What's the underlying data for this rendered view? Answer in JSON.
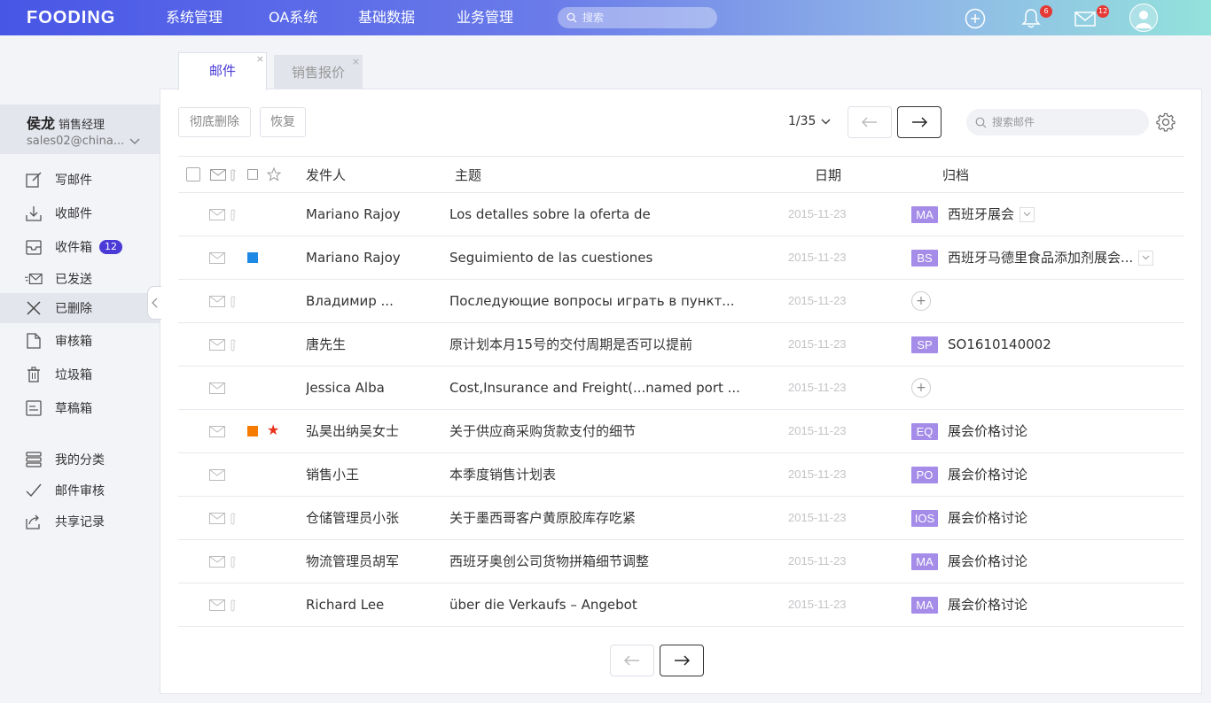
{
  "app": {
    "logo": "FOODING",
    "search_placeholder": "搜索",
    "notif_count": "6",
    "mail_count": "12"
  },
  "nav": [
    "系统管理",
    "OA系统",
    "基础数据",
    "业务管理"
  ],
  "tabs": [
    {
      "label": "邮件",
      "active": true
    },
    {
      "label": "销售报价",
      "active": false
    }
  ],
  "user": {
    "name": "侯龙",
    "role": "销售经理",
    "email": "sales02@china..."
  },
  "sidebar": {
    "items": [
      {
        "label": "写邮件",
        "icon": "compose-icon"
      },
      {
        "label": "收邮件",
        "icon": "download-icon"
      },
      {
        "label": "收件箱",
        "icon": "inbox-icon",
        "badge": "12"
      },
      {
        "label": "已发送",
        "icon": "sent-icon"
      },
      {
        "label": "已删除",
        "icon": "close-icon",
        "active": true
      },
      {
        "label": "审核箱",
        "icon": "document-icon"
      },
      {
        "label": "垃圾箱",
        "icon": "trash-icon"
      },
      {
        "label": "草稿箱",
        "icon": "draft-icon"
      }
    ],
    "extra": [
      {
        "label": "我的分类",
        "icon": "layers-icon"
      },
      {
        "label": "邮件审核",
        "icon": "check-icon"
      },
      {
        "label": "共享记录",
        "icon": "share-icon"
      }
    ]
  },
  "toolbar": {
    "delete_label": "彻底删除",
    "restore_label": "恢复",
    "page": "1/35",
    "search_placeholder": "搜索邮件"
  },
  "table": {
    "headers": {
      "sender": "发件人",
      "subject": "主题",
      "date": "日期",
      "archive": "归档"
    },
    "rows": [
      {
        "sender": "Mariano Rajoy",
        "subject": "Los detalles sobre la oferta de",
        "date": "2015-11-23",
        "attach": true,
        "tag": "MA",
        "archive": "西班牙展会",
        "dropdown": true
      },
      {
        "sender": "Mariano Rajoy",
        "subject": "Seguimiento de las cuestiones",
        "date": "2015-11-23",
        "attach": false,
        "color": "#1e88e5",
        "tag": "BS",
        "archive": "西班牙马德里食品添加剂展会...",
        "dropdown": true
      },
      {
        "sender": "Владимир ...",
        "subject": "Последующие  вопросы  играть в  пункт...",
        "date": "2015-11-23",
        "attach": true,
        "plus": true
      },
      {
        "sender": "唐先生",
        "subject": "原计划本月15号的交付周期是否可以提前",
        "date": "2015-11-23",
        "attach": true,
        "tag": "SP",
        "archive": "SO1610140002"
      },
      {
        "sender": "Jessica Alba",
        "subject": "Cost,Insurance and Freight(...named port  ...",
        "date": "2015-11-23",
        "attach": false,
        "plus": true
      },
      {
        "sender": "弘昊出纳吴女士",
        "subject": "关于供应商采购货款支付的细节",
        "date": "2015-11-23",
        "attach": false,
        "color": "#f57c00",
        "star": true,
        "tag": "EQ",
        "archive": "展会价格讨论"
      },
      {
        "sender": "销售小王",
        "subject": "本季度销售计划表",
        "date": "2015-11-23",
        "attach": false,
        "tag": "PO",
        "archive": "展会价格讨论"
      },
      {
        "sender": "仓储管理员小张",
        "subject": "关于墨西哥客户黄原胶库存吃紧",
        "date": "2015-11-23",
        "attach": true,
        "tag": "IOS",
        "archive": "展会价格讨论"
      },
      {
        "sender": "物流管理员胡军",
        "subject": "西班牙奥创公司货物拼箱细节调整",
        "date": "2015-11-23",
        "attach": true,
        "tag": "MA",
        "archive": "展会价格讨论"
      },
      {
        "sender": "Richard Lee",
        "subject": "über die Verkaufs – Angebot",
        "date": "2015-11-23",
        "attach": true,
        "tag": "MA",
        "archive": "展会价格讨论"
      }
    ]
  },
  "colors": {
    "accent": "#4a3ad6",
    "tag": "#a48ce8"
  }
}
